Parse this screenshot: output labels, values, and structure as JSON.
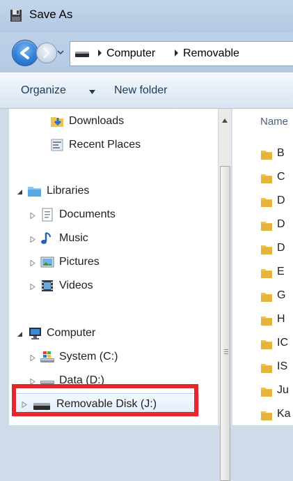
{
  "window": {
    "title": "Save As"
  },
  "address": {
    "crumbs": [
      "Computer",
      "Removable"
    ]
  },
  "toolbar": {
    "organize": "Organize",
    "new_folder": "New folder"
  },
  "nav": {
    "items": [
      {
        "label": "Downloads",
        "icon": "downloads-folder-icon"
      },
      {
        "label": "Recent Places",
        "icon": "recent-places-icon"
      },
      {
        "label": "Libraries",
        "icon": "libraries-icon",
        "expanded": true
      },
      {
        "label": "Documents",
        "icon": "documents-icon"
      },
      {
        "label": "Music",
        "icon": "music-icon"
      },
      {
        "label": "Pictures",
        "icon": "pictures-icon"
      },
      {
        "label": "Videos",
        "icon": "videos-icon"
      },
      {
        "label": "Computer",
        "icon": "computer-icon",
        "expanded": true
      },
      {
        "label": "System (C:)",
        "icon": "system-drive-icon"
      },
      {
        "label": "Data (D:)",
        "icon": "data-drive-icon"
      },
      {
        "label": "Removable Disk (J:)",
        "icon": "removable-drive-icon",
        "selected": true
      }
    ]
  },
  "content": {
    "column_header": "Name",
    "files": [
      "B",
      "C",
      "D",
      "D",
      "D",
      "E",
      "G",
      "H",
      "IC",
      "IS",
      "Ju",
      "Ka"
    ]
  },
  "colors": {
    "highlight_border": "#e4262d",
    "selection_bg": "#e1eefb",
    "folder": "#f0c24b"
  }
}
